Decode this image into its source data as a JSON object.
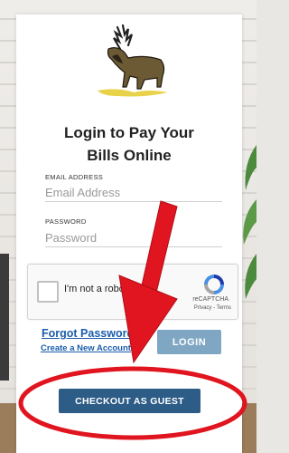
{
  "title_line1": "Login to Pay Your",
  "title_line2": "Bills Online",
  "email": {
    "label": "EMAIL ADDRESS",
    "placeholder": "Email Address"
  },
  "password": {
    "label": "PASSWORD",
    "placeholder": "Password"
  },
  "captcha": {
    "text": "I'm not a robot",
    "brand": "reCAPTCHA",
    "links": "Privacy - Terms"
  },
  "forgot_password": "Forgot Password",
  "create_account": "Create a New Account",
  "login_label": "LOGIN",
  "guest_label": "CHECKOUT AS GUEST",
  "colors": {
    "arrow": "#e0151f",
    "primary": "#2d5c86",
    "login": "#7fa7c4",
    "link": "#1a5cab"
  }
}
